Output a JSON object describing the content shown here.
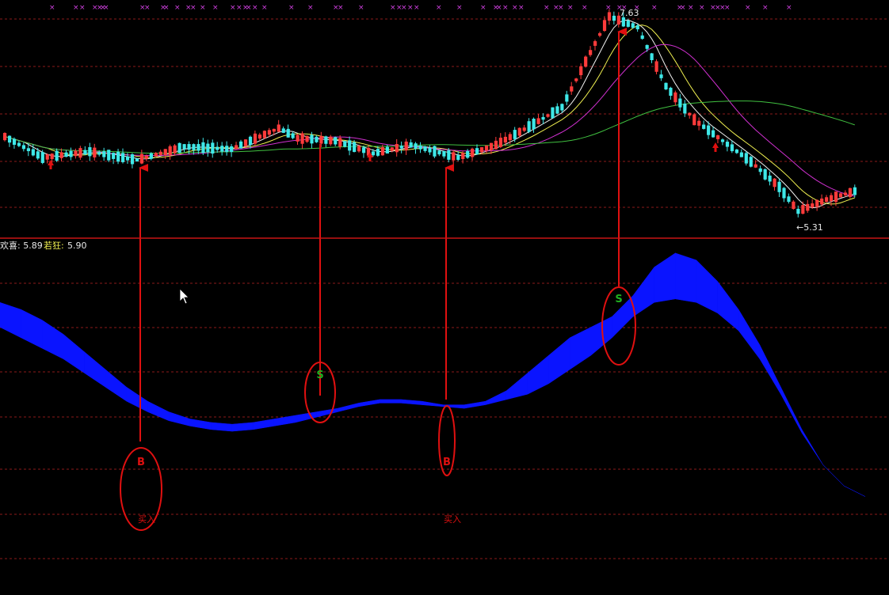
{
  "colors": {
    "background": "#000000",
    "grid": "#8b1a1a",
    "divider": "#c81414",
    "candle_up": "#ff3b3b",
    "candle_down": "#3ee8e8",
    "ma_white": "#f2f2f2",
    "ma_yellow": "#f0f050",
    "ma_magenta": "#d030d0",
    "ma_green": "#40c040",
    "signal_mark": "#d040e0",
    "ribbon_blue": "#0a14ff",
    "ribbon_maroon": "#8a0a3a",
    "annotation": "#e01010",
    "sell_text": "#20b020",
    "legend_white": "#e8e8e8",
    "legend_yellow": "#f0f050"
  },
  "legend": {
    "item1": "欢喜: 5.89",
    "item2_label": "若狂: ",
    "item2_value": "5.90"
  },
  "price_labels": {
    "high": "7.63",
    "low": "←5.31"
  },
  "annotations": {
    "buy_letter": "B",
    "sell_letter": "S",
    "buy_text": "买入"
  },
  "chart_data": {
    "type": "candlestick",
    "panels": [
      "price",
      "indicator"
    ],
    "price": {
      "ylim": [
        5.0,
        7.75
      ],
      "marked_high": 7.63,
      "marked_low": 5.31
    },
    "indicator": {
      "series": [
        {
          "values": [
            0.82,
            0.8,
            0.77,
            0.73,
            0.68,
            0.63,
            0.58,
            0.54,
            0.51,
            0.49,
            0.48,
            0.475,
            0.48,
            0.49,
            0.5,
            0.51,
            0.52,
            0.535,
            0.545,
            0.545,
            0.54,
            0.53,
            0.53,
            0.54,
            0.57,
            0.62,
            0.67,
            0.72,
            0.75,
            0.78,
            0.84,
            0.92,
            0.96,
            0.94,
            0.88,
            0.8,
            0.7,
            0.58,
            0.46,
            0.36,
            0.3,
            0.27
          ]
        },
        {
          "values": [
            0.75,
            0.72,
            0.69,
            0.66,
            0.62,
            0.58,
            0.54,
            0.51,
            0.485,
            0.47,
            0.46,
            0.455,
            0.46,
            0.47,
            0.48,
            0.495,
            0.51,
            0.525,
            0.535,
            0.535,
            0.53,
            0.525,
            0.52,
            0.53,
            0.545,
            0.56,
            0.59,
            0.63,
            0.67,
            0.72,
            0.78,
            0.82,
            0.83,
            0.82,
            0.79,
            0.74,
            0.66,
            0.56,
            0.45,
            0.36,
            0.3,
            0.27
          ]
        }
      ],
      "signals": [
        {
          "type": "buy",
          "index": 9
        },
        {
          "type": "sell",
          "index": 16
        },
        {
          "type": "buy",
          "index": 22
        },
        {
          "type": "sell",
          "index": 30
        }
      ]
    }
  }
}
